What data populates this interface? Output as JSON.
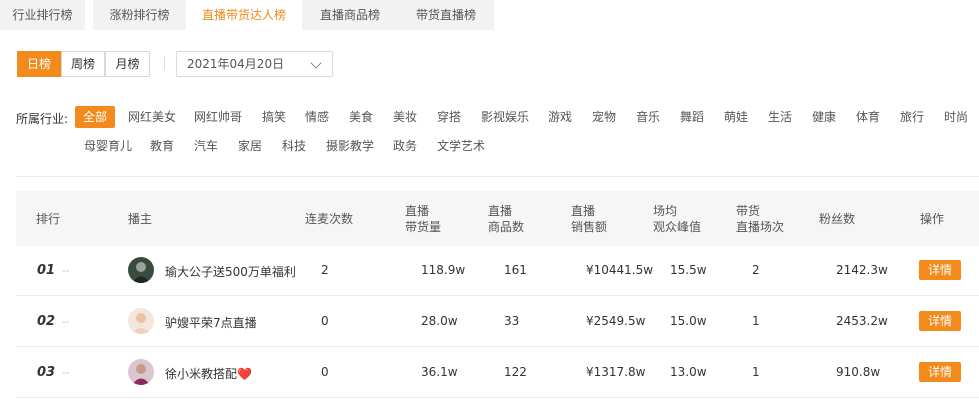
{
  "tabs": [
    "行业排行榜",
    "涨粉排行榜",
    "直播带货达人榜",
    "直播商品榜",
    "带货直播榜"
  ],
  "period": {
    "options": [
      "日榜",
      "周榜",
      "月榜"
    ],
    "active": "日榜"
  },
  "date": "2021年04月20日",
  "industry": {
    "label": "所属行业:",
    "active": "全部",
    "row1": [
      "全部",
      "网红美女",
      "网红帅哥",
      "搞笑",
      "情感",
      "美食",
      "美妆",
      "穿搭",
      "影视娱乐",
      "游戏",
      "宠物",
      "音乐",
      "舞蹈",
      "萌娃",
      "生活",
      "健康",
      "体育",
      "旅行",
      "时尚"
    ],
    "row2": [
      "母婴育儿",
      "教育",
      "汽车",
      "家居",
      "科技",
      "摄影教学",
      "政务",
      "文学艺术"
    ]
  },
  "table": {
    "headers": {
      "rank": "排行",
      "anchor": "播主",
      "link_count": "连麦次数",
      "sales_volume": [
        "直播",
        "带货量"
      ],
      "product_count": [
        "直播",
        "商品数"
      ],
      "sales_amount": [
        "直播",
        "销售额"
      ],
      "peak_viewers": [
        "场均",
        "观众峰值"
      ],
      "live_sessions": [
        "带货",
        "直播场次"
      ],
      "fans": "粉丝数",
      "action": "操作"
    },
    "rows": [
      {
        "rank": "01",
        "dash": "--",
        "name": "瑜大公子送500万单福利",
        "link_count": "2",
        "sales_volume": "118.9w",
        "product_count": "161",
        "sales_amount": "¥10441.5w",
        "peak_viewers": "15.5w",
        "live_sessions": "2",
        "fans": "2142.3w",
        "action": "详情"
      },
      {
        "rank": "02",
        "dash": "--",
        "name": "驴嫂平荣7点直播",
        "link_count": "0",
        "sales_volume": "28.0w",
        "product_count": "33",
        "sales_amount": "¥2549.5w",
        "peak_viewers": "15.0w",
        "live_sessions": "1",
        "fans": "2453.2w",
        "action": "详情"
      },
      {
        "rank": "03",
        "dash": "--",
        "name": "徐小米教搭配❤️",
        "link_count": "0",
        "sales_volume": "36.1w",
        "product_count": "122",
        "sales_amount": "¥1317.8w",
        "peak_viewers": "13.0w",
        "live_sessions": "1",
        "fans": "910.8w",
        "action": "详情"
      }
    ]
  },
  "colors": {
    "accent": "#f28a1c",
    "header_bg": "#f6f6f6",
    "tab_bg": "#f2f2f2"
  }
}
